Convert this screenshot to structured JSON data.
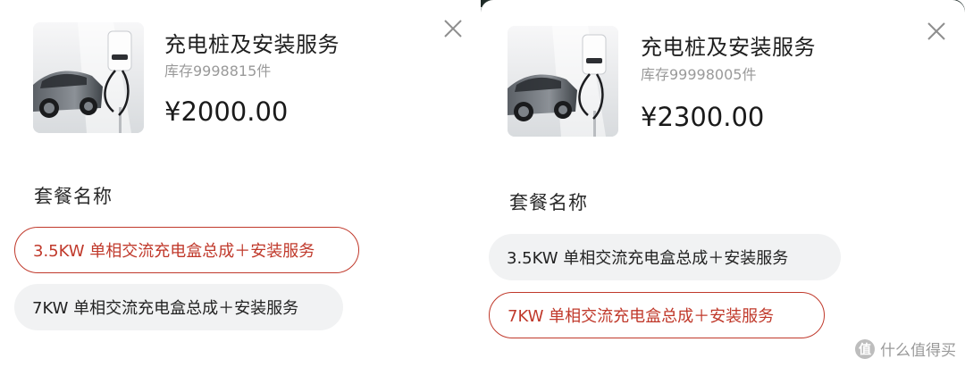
{
  "left": {
    "product_title": "充电桩及安装服务",
    "stock": "库存9998815件",
    "price": "¥2000.00",
    "section_title": "套餐名称",
    "options": [
      {
        "label": "3.5KW 单相交流充电盒总成＋安装服务",
        "selected": true
      },
      {
        "label": "7KW 单相交流充电盒总成＋安装服务",
        "selected": false
      }
    ]
  },
  "right": {
    "product_title": "充电桩及安装服务",
    "stock": "库存99998005件",
    "price": "¥2300.00",
    "section_title": "套餐名称",
    "options": [
      {
        "label": "3.5KW 单相交流充电盒总成＋安装服务",
        "selected": false
      },
      {
        "label": "7KW 单相交流充电盒总成＋安装服务",
        "selected": true
      }
    ]
  },
  "watermark": {
    "badge": "值",
    "text": "什么值得买"
  },
  "colors": {
    "accent": "#c0392b",
    "chip_bg": "#f1f2f3",
    "text_primary": "#1f1f1f",
    "text_secondary": "#9a9a9a"
  },
  "icons": {
    "close": "close-icon",
    "product_image": "ev-charger-with-car"
  }
}
